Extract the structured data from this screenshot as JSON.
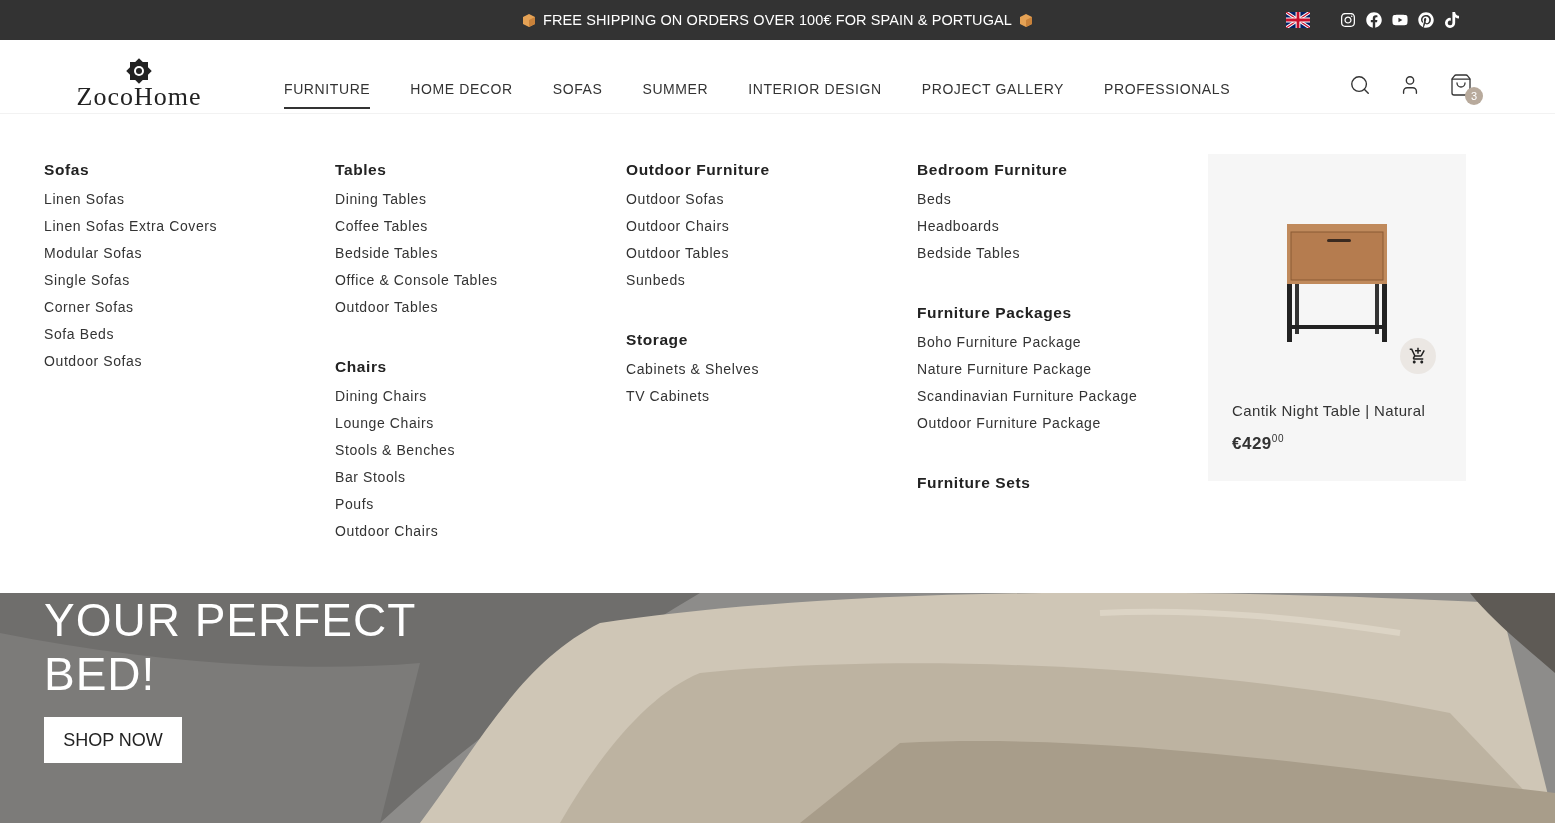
{
  "announcement": {
    "text": "FREE SHIPPING ON ORDERS OVER 100€ FOR SPAIN & PORTUGAL"
  },
  "header": {
    "logo": "ZocoHome",
    "nav": [
      {
        "label": "FURNITURE",
        "selected": true
      },
      {
        "label": "HOME DECOR",
        "selected": false
      },
      {
        "label": "SOFAS",
        "selected": false
      },
      {
        "label": "SUMMER",
        "selected": false
      },
      {
        "label": "INTERIOR DESIGN",
        "selected": false
      },
      {
        "label": "PROJECT GALLERY",
        "selected": false
      },
      {
        "label": "PROFESSIONALS",
        "selected": false
      }
    ],
    "cart_count": "3"
  },
  "mega_menu": {
    "columns": [
      [
        {
          "heading": "Sofas",
          "links": [
            "Linen Sofas",
            "Linen Sofas Extra Covers",
            "Modular Sofas",
            "Single Sofas",
            "Corner Sofas",
            "Sofa Beds",
            "Outdoor Sofas"
          ]
        }
      ],
      [
        {
          "heading": "Tables",
          "links": [
            "Dining Tables",
            "Coffee Tables",
            "Bedside Tables",
            "Office & Console Tables",
            "Outdoor Tables"
          ]
        },
        {
          "heading": "Chairs",
          "links": [
            "Dining Chairs",
            "Lounge Chairs",
            "Stools & Benches",
            "Bar Stools",
            "Poufs",
            "Outdoor Chairs"
          ]
        }
      ],
      [
        {
          "heading": "Outdoor Furniture",
          "links": [
            "Outdoor Sofas",
            "Outdoor Chairs",
            "Outdoor Tables",
            "Sunbeds"
          ]
        },
        {
          "heading": "Storage",
          "links": [
            "Cabinets & Shelves",
            "TV Cabinets"
          ]
        }
      ],
      [
        {
          "heading": "Bedroom Furniture",
          "links": [
            "Beds",
            "Headboards",
            "Bedside Tables"
          ]
        },
        {
          "heading": "Furniture Packages",
          "links": [
            "Boho Furniture Package",
            "Nature Furniture Package",
            "Scandinavian Furniture Package",
            "Outdoor Furniture Package"
          ]
        },
        {
          "heading": "Furniture Sets"
        }
      ]
    ],
    "product": {
      "name": "Cantik Night Table | Natural",
      "price": "€429$^{00}$"
    }
  },
  "hero": {
    "title": "YOUR PERFECT BED!",
    "button": "SHOP NOW"
  }
}
